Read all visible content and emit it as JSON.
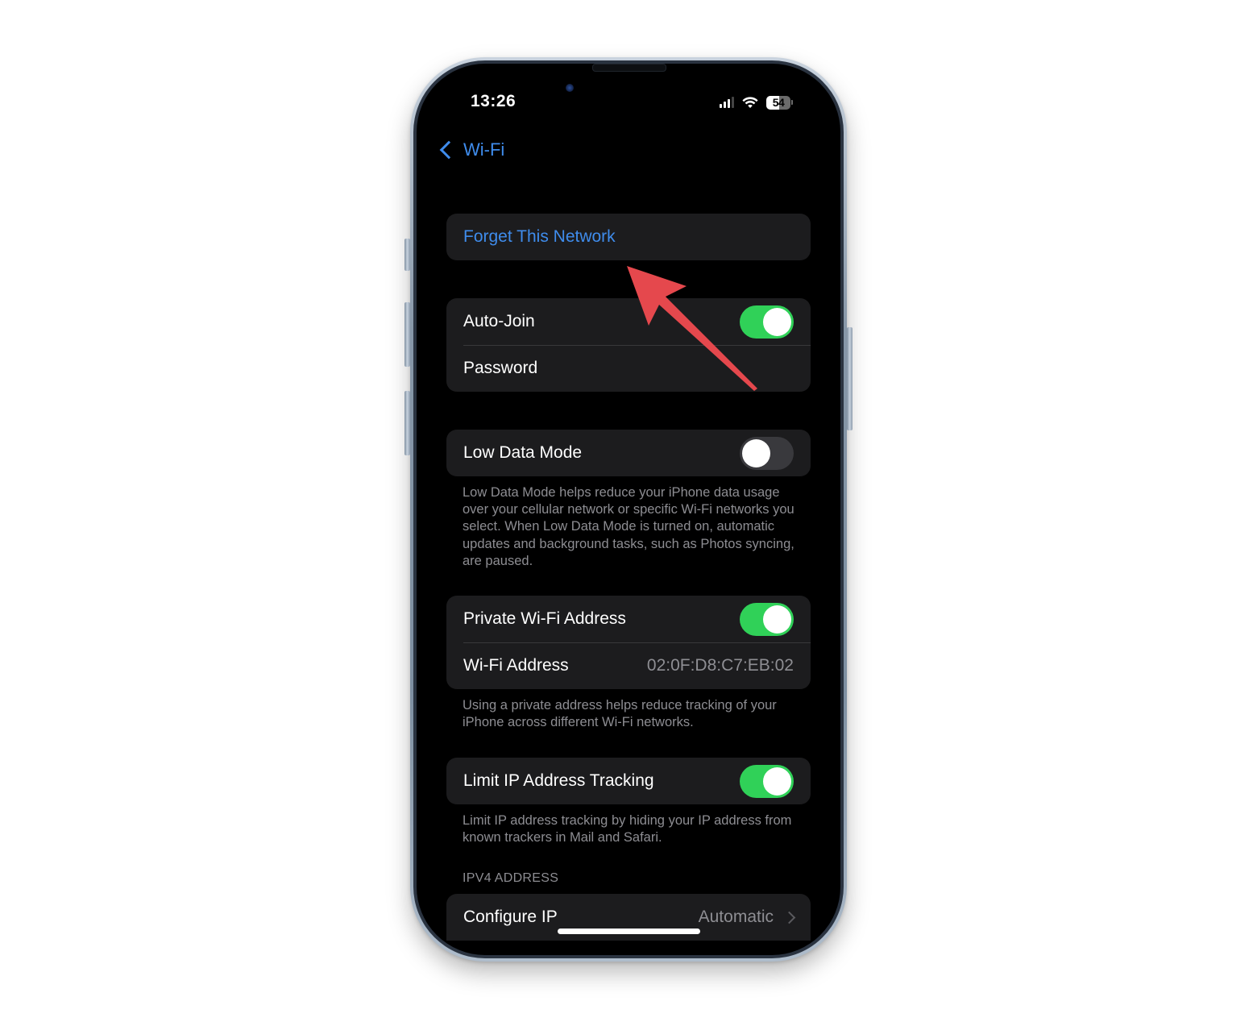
{
  "status_bar": {
    "time": "13:26",
    "battery_percent": "54",
    "battery_level": 0.54,
    "signal_bars_active": 3,
    "signal_bars_total": 4,
    "icons": [
      "cellular-signal-icon",
      "wifi-icon",
      "battery-icon"
    ]
  },
  "nav": {
    "back_label": "Wi-Fi",
    "back_icon": "chevron-left-icon"
  },
  "groups": {
    "forget": {
      "label": "Forget This Network"
    },
    "join": {
      "auto_join_label": "Auto-Join",
      "auto_join_on": true,
      "password_label": "Password"
    },
    "low_data": {
      "label": "Low Data Mode",
      "on": false,
      "footnote": "Low Data Mode helps reduce your iPhone data usage over your cellular network or specific Wi-Fi networks you select. When Low Data Mode is turned on, automatic updates and background tasks, such as Photos syncing, are paused."
    },
    "private_address": {
      "label": "Private Wi-Fi Address",
      "on": true,
      "address_label": "Wi-Fi Address",
      "address_value": "02:0F:D8:C7:EB:02",
      "footnote": "Using a private address helps reduce tracking of your iPhone across different Wi-Fi networks."
    },
    "limit_ip": {
      "label": "Limit IP Address Tracking",
      "on": true,
      "footnote": "Limit IP address tracking by hiding your IP address from known trackers in Mail and Safari."
    },
    "ipv4": {
      "header": "IPV4 ADDRESS",
      "configure_label": "Configure IP",
      "configure_value": "Automatic"
    }
  },
  "annotation": {
    "type": "arrow",
    "color": "#e5484d",
    "points_to": "Forget This Network"
  },
  "colors": {
    "accent_blue": "#3f8cec",
    "toggle_on": "#30d158",
    "toggle_off": "#39393d",
    "cell_bg": "#1c1c1e",
    "screen_bg": "#000000"
  }
}
